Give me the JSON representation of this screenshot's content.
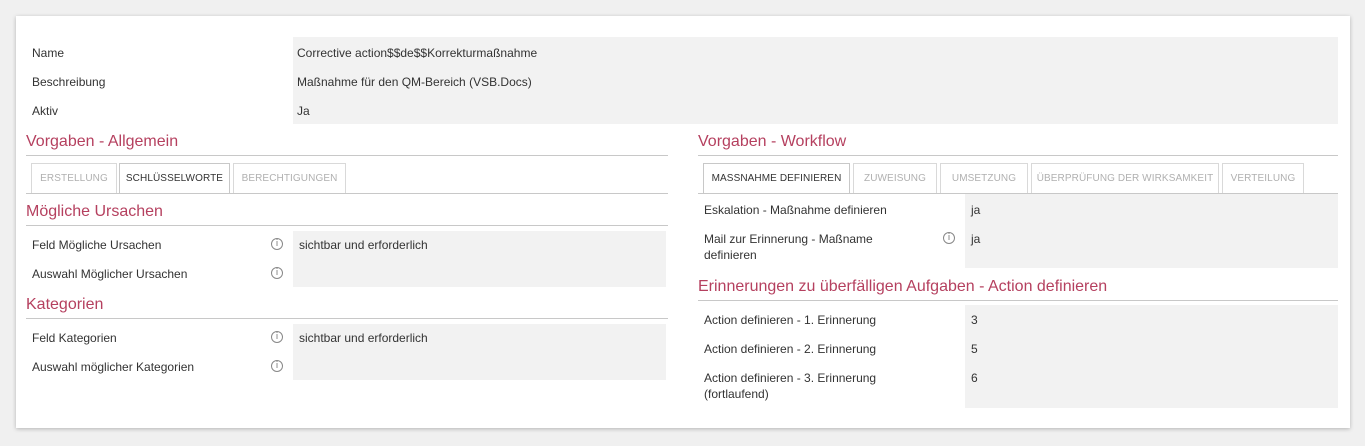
{
  "header": {
    "rows": [
      {
        "label": "Name",
        "value": "Corrective action$$de$$Korrekturmaßnahme"
      },
      {
        "label": "Beschreibung",
        "value": "Maßnahme für den QM-Bereich (VSB.Docs)"
      },
      {
        "label": "Aktiv",
        "value": "Ja"
      }
    ]
  },
  "left": {
    "title": "Vorgaben - Allgemein",
    "tabs": [
      "ERSTELLUNG",
      "SCHLÜSSELWORTE",
      "BERECHTIGUNGEN"
    ],
    "active_tab": "SCHLÜSSELWORTE",
    "sections": [
      {
        "title": "Mögliche Ursachen",
        "rows": [
          {
            "label": "Feld Mögliche Ursachen",
            "value": "sichtbar und erforderlich"
          },
          {
            "label": "Auswahl Möglicher Ursachen",
            "value": ""
          }
        ]
      },
      {
        "title": "Kategorien",
        "rows": [
          {
            "label": "Feld Kategorien",
            "value": "sichtbar und erforderlich"
          },
          {
            "label": "Auswahl möglicher Kategorien",
            "value": ""
          }
        ]
      }
    ]
  },
  "right": {
    "title": "Vorgaben - Workflow",
    "tabs": [
      "MASSNAHME DEFINIEREN",
      "ZUWEISUNG",
      "UMSETZUNG",
      "ÜBERPRÜFUNG DER WIRKSAMKEIT",
      "VERTEILUNG"
    ],
    "active_tab": "MASSNAHME DEFINIEREN",
    "rows": [
      {
        "label": "Eskalation - Maßnahme definieren",
        "value": "ja"
      },
      {
        "label": "Mail zur Erinnerung - Maßname definieren",
        "value": "ja"
      }
    ],
    "reminders": {
      "title": "Erinnerungen zu überfälligen Aufgaben - Action definieren",
      "rows": [
        {
          "label": "Action definieren - 1. Erinnerung",
          "value": "3"
        },
        {
          "label": "Action definieren - 2. Erinnerung",
          "value": "5"
        },
        {
          "label": "Action definieren - 3. Erinnerung (fortlaufend)",
          "value": "6"
        }
      ]
    }
  },
  "icons": {
    "info": "info-circle-icon",
    "glyph": "i"
  },
  "colors": {
    "accent": "#b5405f",
    "value_bg": "#f2f2f2"
  }
}
